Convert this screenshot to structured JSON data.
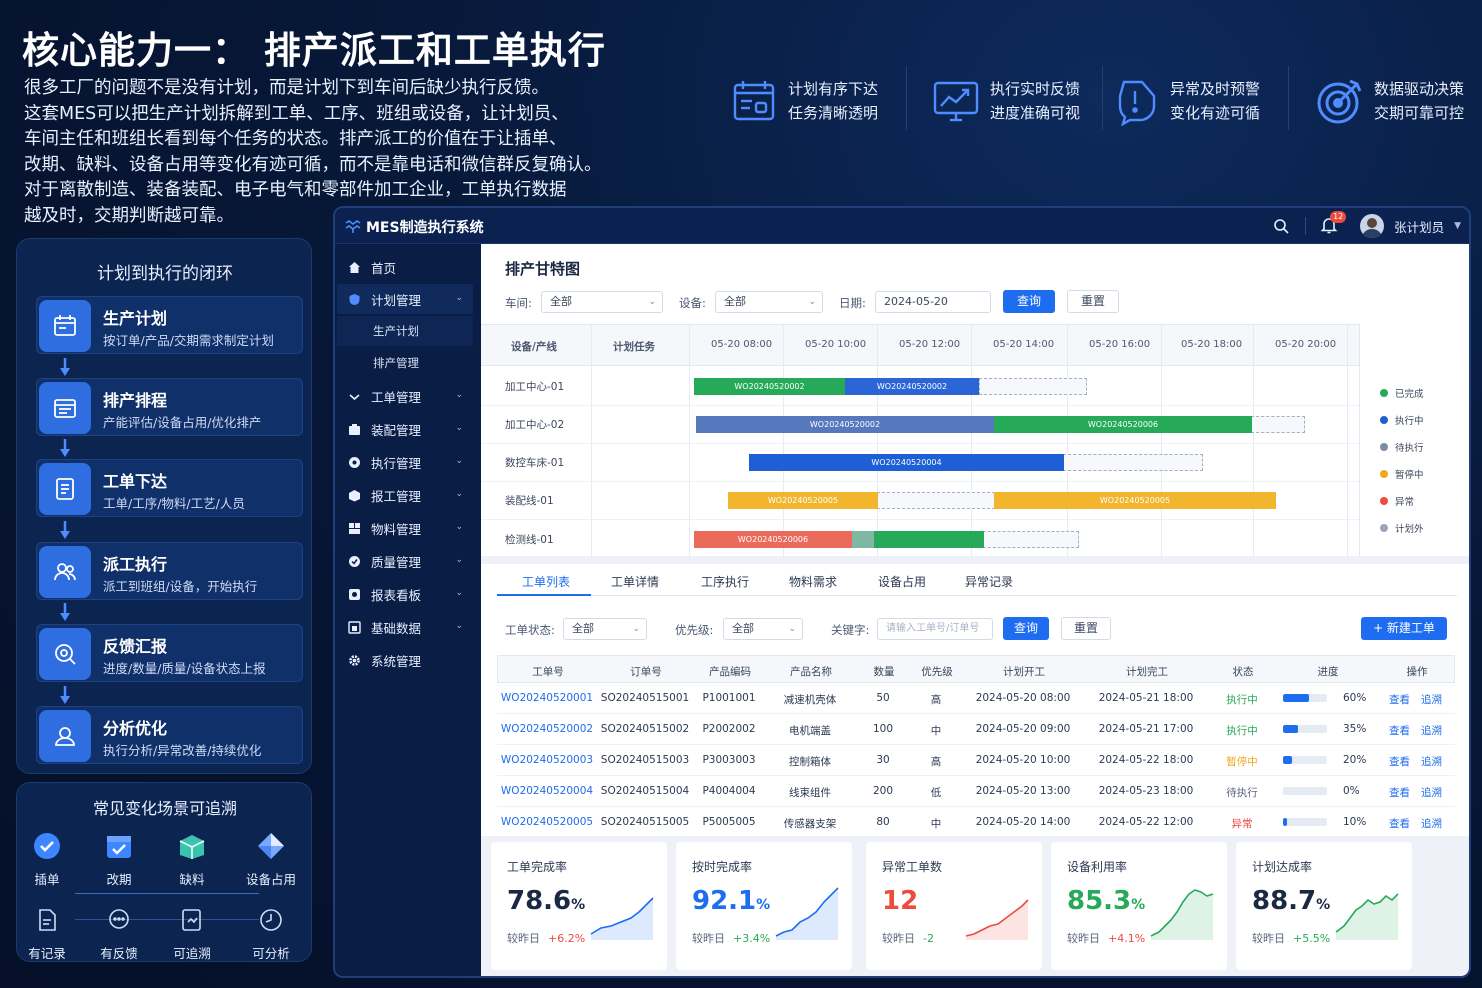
{
  "headline": "核心能力一：  排产派工和工单执行",
  "intro_lines": [
    "很多工厂的问题不是没有计划，而是计划下到车间后缺少执行反馈。",
    "这套MES可以把生产计划拆解到工单、工序、班组或设备，让计划员、",
    "车间主任和班组长看到每个任务的状态。排产派工的价值在于让插单、",
    "改期、缺料、设备占用等变化有迹可循，而不是靠电话和微信群反复确认。",
    "对于离散制造、装备装配、电子电气和零部件加工企业，工单执行数据",
    "越及时，交期判断越可靠。"
  ],
  "features": [
    {
      "icon": "calendar-list-icon",
      "line1": "计划有序下达",
      "line2": "任务清晰透明"
    },
    {
      "icon": "monitor-chart-icon",
      "line1": "执行实时反馈",
      "line2": "进度准确可视"
    },
    {
      "icon": "alert-shield-icon",
      "line1": "异常及时预警",
      "line2": "变化有迹可循"
    },
    {
      "icon": "target-icon",
      "line1": "数据驱动决策",
      "line2": "交期可靠可控"
    }
  ],
  "loop": {
    "title": "计划到执行的闭环",
    "steps": [
      {
        "title": "生产计划",
        "desc": "按订单/产品/交期需求制定计划",
        "icon": "calendar-icon"
      },
      {
        "title": "排产排程",
        "desc": "产能评估/设备占用/优化排产",
        "icon": "schedule-icon"
      },
      {
        "title": "工单下达",
        "desc": "工单/工序/物料/工艺/人员",
        "icon": "document-list-icon"
      },
      {
        "title": "派工执行",
        "desc": "派工到班组/设备，开始执行",
        "icon": "users-icon"
      },
      {
        "title": "反馈汇报",
        "desc": "进度/数量/质量/设备状态上报",
        "icon": "feedback-icon"
      },
      {
        "title": "分析优化",
        "desc": "执行分析/异常改善/持续优化",
        "icon": "analysis-icon"
      }
    ]
  },
  "trace": {
    "title": "常见变化场景可追溯",
    "top": [
      {
        "label": "插单",
        "icon": "check-circle-icon"
      },
      {
        "label": "改期",
        "icon": "calendar-check-icon"
      },
      {
        "label": "缺料",
        "icon": "box-icon"
      },
      {
        "label": "设备占用",
        "icon": "diamond-icon"
      }
    ],
    "bottom": [
      {
        "label": "有记录",
        "icon": "record-icon"
      },
      {
        "label": "有反馈",
        "icon": "chat-icon"
      },
      {
        "label": "可追溯",
        "icon": "trace-icon"
      },
      {
        "label": "可分析",
        "icon": "clock-chart-icon"
      }
    ]
  },
  "app": {
    "title": "MES制造执行系统",
    "badge": "12",
    "user": "张计划员",
    "menu": [
      {
        "label": "首页",
        "icon": "home-icon",
        "chev": false
      },
      {
        "label": "计划管理",
        "icon": "shield-icon",
        "chev": true
      },
      {
        "label": "工单管理",
        "icon": "ticket-icon",
        "chev": true
      },
      {
        "label": "装配管理",
        "icon": "assembly-icon",
        "chev": true
      },
      {
        "label": "执行管理",
        "icon": "gear-icon",
        "chev": true
      },
      {
        "label": "报工管理",
        "icon": "cube-icon",
        "chev": true
      },
      {
        "label": "物料管理",
        "icon": "material-icon",
        "chev": true
      },
      {
        "label": "质量管理",
        "icon": "quality-icon",
        "chev": true
      },
      {
        "label": "报表看板",
        "icon": "board-icon",
        "chev": true
      },
      {
        "label": "基础数据",
        "icon": "database-icon",
        "chev": true
      },
      {
        "label": "系统管理",
        "icon": "settings-icon",
        "chev": false
      }
    ],
    "submenu": [
      "生产计划",
      "排产管理"
    ]
  },
  "gantt_panel": {
    "title": "排产甘特图",
    "filters": {
      "workshop_label": "车间:",
      "workshop_value": "全部",
      "device_label": "设备:",
      "device_value": "全部",
      "date_label": "日期:",
      "date_value": "2024-05-20",
      "query": "查询",
      "reset": "重置"
    },
    "col_device": "设备/产线",
    "col_task": "计划任务",
    "times": [
      "05-20 08:00",
      "05-20 10:00",
      "05-20 12:00",
      "05-20 14:00",
      "05-20 16:00",
      "05-20 18:00",
      "05-20 20:00"
    ],
    "rows": [
      "加工中心-01",
      "加工中心-02",
      "数控车床-01",
      "装配线-01",
      "检测线-01"
    ],
    "bar_labels": [
      "WO20240520002",
      "WO20240520002",
      "WO20240520002",
      "WO20240520006",
      "WO20240520004",
      "WO20240520005",
      "WO20240520005",
      "WO20240520006"
    ],
    "legend": [
      {
        "label": "已完成",
        "color": "#27a95a"
      },
      {
        "label": "执行中",
        "color": "#1e5fd6"
      },
      {
        "label": "待执行",
        "color": "#7d8ba3"
      },
      {
        "label": "暂停中",
        "color": "#f2a81c"
      },
      {
        "label": "异常",
        "color": "#ec4b3e"
      },
      {
        "label": "计划外",
        "color": "#9aa5b8"
      }
    ]
  },
  "orders_panel": {
    "tabs": [
      "工单列表",
      "工单详情",
      "工序执行",
      "物料需求",
      "设备占用",
      "异常记录"
    ],
    "filters": {
      "status_label": "工单状态:",
      "status_value": "全部",
      "priority_label": "优先级:",
      "priority_value": "全部",
      "keyword_label": "关键字:",
      "keyword_placeholder": "请输入工单号/订单号",
      "query": "查询",
      "reset": "重置",
      "new": "+ 新建工单"
    },
    "headers": [
      "工单号",
      "订单号",
      "产品编码",
      "产品名称",
      "数量",
      "优先级",
      "计划开工",
      "计划完工",
      "状态",
      "进度",
      "操作"
    ],
    "rows": [
      {
        "wo": "WO20240520001",
        "so": "SO20240515001",
        "code": "P1001001",
        "name": "减速机壳体",
        "qty": "50",
        "pri": "高",
        "start": "2024-05-20 08:00",
        "end": "2024-05-21 18:00",
        "status": "执行中",
        "status_color": "#27a95a",
        "progress": "60%",
        "pct": 0.6,
        "view": "查看",
        "trace": "追溯"
      },
      {
        "wo": "WO20240520002",
        "so": "SO20240515002",
        "code": "P2002002",
        "name": "电机端盖",
        "qty": "100",
        "pri": "中",
        "start": "2024-05-20 09:00",
        "end": "2024-05-21 17:00",
        "status": "执行中",
        "status_color": "#27a95a",
        "progress": "35%",
        "pct": 0.35,
        "view": "查看",
        "trace": "追溯"
      },
      {
        "wo": "WO20240520003",
        "so": "SO20240515003",
        "code": "P3003003",
        "name": "控制箱体",
        "qty": "30",
        "pri": "高",
        "start": "2024-05-20 10:00",
        "end": "2024-05-22 18:00",
        "status": "暂停中",
        "status_color": "#f2a81c",
        "progress": "20%",
        "pct": 0.2,
        "view": "查看",
        "trace": "追溯"
      },
      {
        "wo": "WO20240520004",
        "so": "SO20240515004",
        "code": "P4004004",
        "name": "线束组件",
        "qty": "200",
        "pri": "低",
        "start": "2024-05-20 13:00",
        "end": "2024-05-23 18:00",
        "status": "待执行",
        "status_color": "#5a667c",
        "progress": "0%",
        "pct": 0,
        "view": "查看",
        "trace": "追溯"
      },
      {
        "wo": "WO20240520005",
        "so": "SO20240515005",
        "code": "P5005005",
        "name": "传感器支架",
        "qty": "80",
        "pri": "中",
        "start": "2024-05-20 14:00",
        "end": "2024-05-22 12:00",
        "status": "异常",
        "status_color": "#ec4b3e",
        "progress": "10%",
        "pct": 0.1,
        "view": "查看",
        "trace": "追溯"
      }
    ]
  },
  "kpis": [
    {
      "title": "工单完成率",
      "value": "78.6",
      "unit": "%",
      "value_color": "#1b2844",
      "delta_label": "较昨日",
      "delta": "+6.2%",
      "delta_color": "#ec4b3e",
      "spark": "#1e6cf0"
    },
    {
      "title": "按时完成率",
      "value": "92.1",
      "unit": "%",
      "value_color": "#1e6cf0",
      "delta_label": "较昨日",
      "delta": "+3.4%",
      "delta_color": "#27a95a",
      "spark": "#1e6cf0"
    },
    {
      "title": "异常工单数",
      "value": "12",
      "unit": "",
      "value_color": "#ec4b3e",
      "delta_label": "较昨日",
      "delta": "-2",
      "delta_color": "#27a95a",
      "spark": "#ec4b3e"
    },
    {
      "title": "设备利用率",
      "value": "85.3",
      "unit": "%",
      "value_color": "#27a95a",
      "delta_label": "较昨日",
      "delta": "+4.1%",
      "delta_color": "#ec4b3e",
      "spark": "#27a95a"
    },
    {
      "title": "计划达成率",
      "value": "88.7",
      "unit": "%",
      "value_color": "#1b2844",
      "delta_label": "较昨日",
      "delta": "+5.5%",
      "delta_color": "#27a95a",
      "spark": "#27a95a"
    }
  ]
}
